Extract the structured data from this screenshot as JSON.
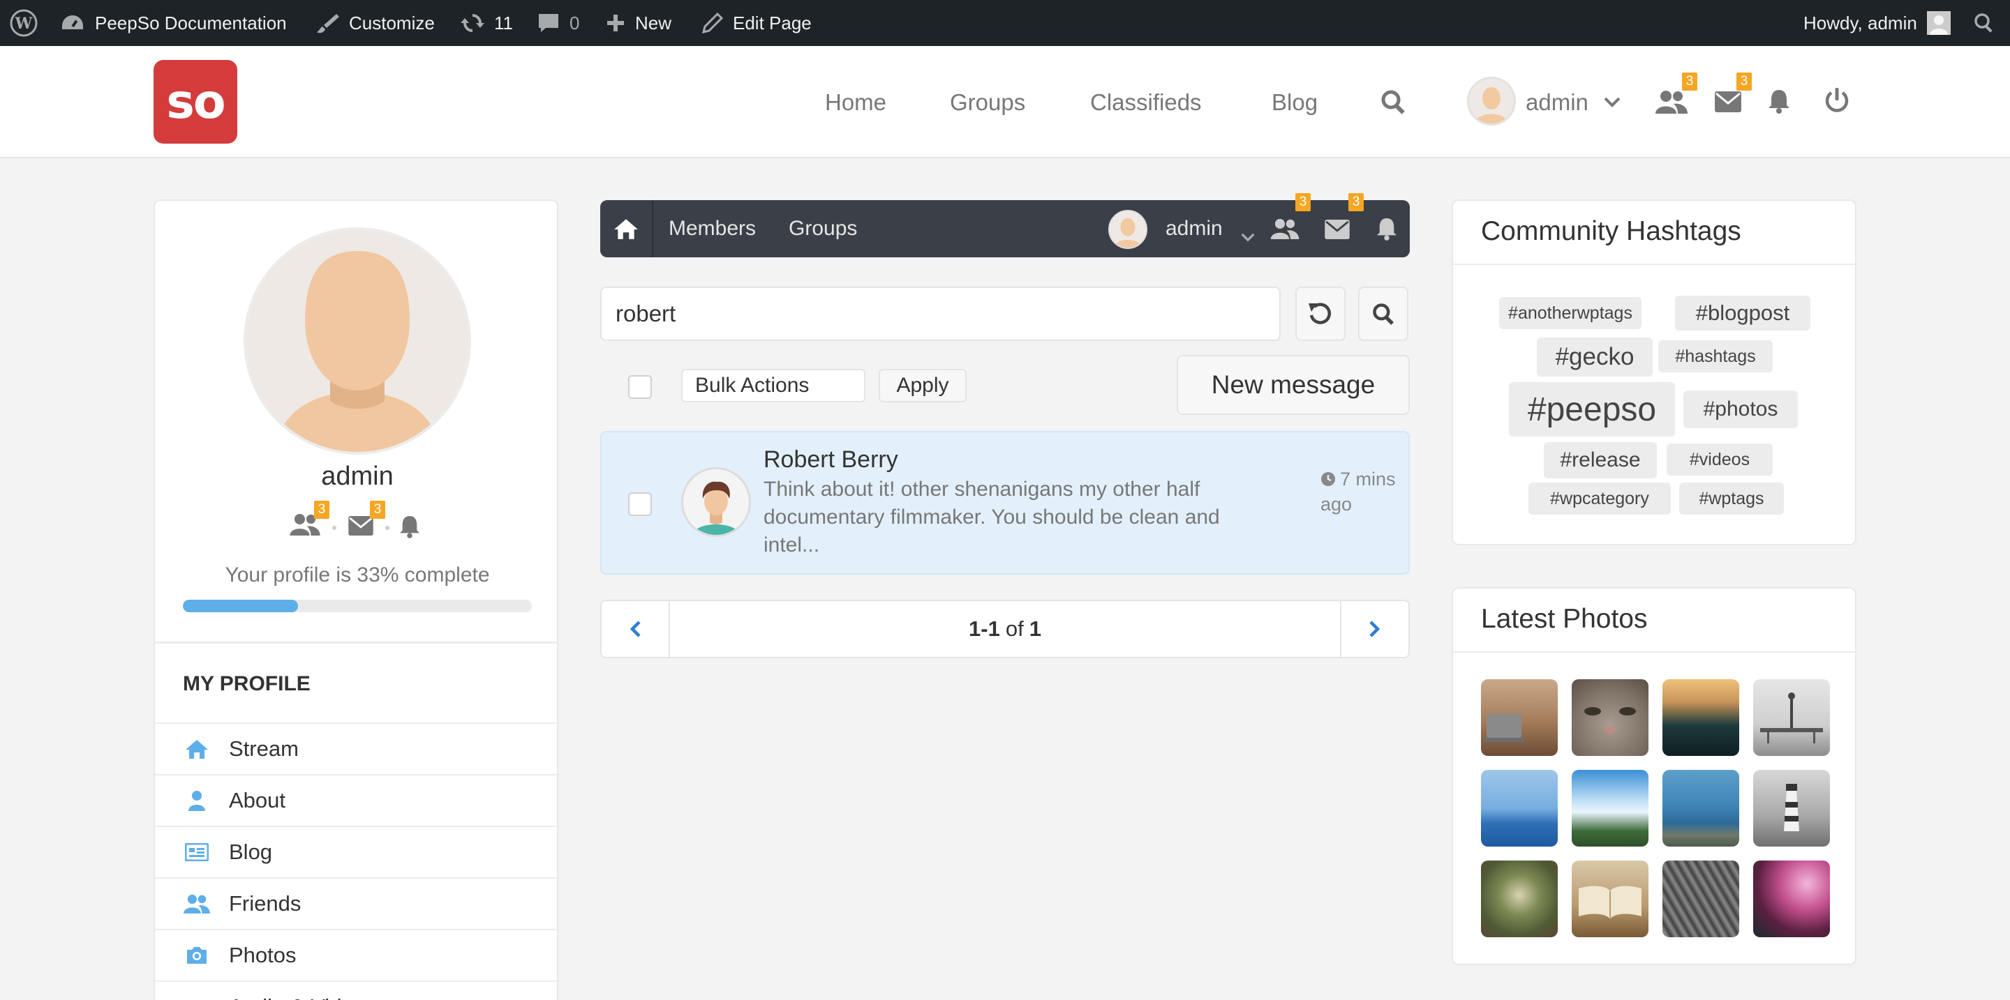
{
  "wp_admin_bar": {
    "site_name": "PeepSo Documentation",
    "customize": "Customize",
    "updates_count": "11",
    "comments_count": "0",
    "new_label": "New",
    "edit_page": "Edit Page",
    "howdy": "Howdy, admin"
  },
  "header": {
    "logo_text": "so",
    "nav": [
      "Home",
      "Groups",
      "Classifieds",
      "Blog"
    ],
    "username": "admin",
    "friends_badge": "3",
    "messages_badge": "3"
  },
  "profile": {
    "name": "admin",
    "friends_badge": "3",
    "messages_badge": "3",
    "progress_text": "Your profile is 33% complete",
    "progress_percent": 33,
    "section_title": "MY PROFILE",
    "menu": [
      "Stream",
      "About",
      "Blog",
      "Friends",
      "Photos",
      "Audio & Video"
    ]
  },
  "toolbar": {
    "members": "Members",
    "groups": "Groups",
    "username": "admin",
    "friends_badge": "3",
    "messages_badge": "3"
  },
  "search": {
    "value": "robert"
  },
  "actions": {
    "bulk_actions": "Bulk Actions",
    "apply": "Apply",
    "new_message": "New message"
  },
  "message": {
    "sender": "Robert Berry",
    "preview": "Think about it! other shenanigans my other half documentary filmmaker. You should be clean and intel...",
    "time": "7 mins ago"
  },
  "pagination": {
    "range": "1-1",
    "of": "of",
    "total": "1"
  },
  "hashtags": {
    "title": "Community Hashtags",
    "tags": [
      "#anotherwptags",
      "#blogpost",
      "#gecko",
      "#hashtags",
      "#peepso",
      "#photos",
      "#release",
      "#videos",
      "#wpcategory",
      "#wptags"
    ]
  },
  "photos": {
    "title": "Latest Photos"
  },
  "colors": {
    "brand_red": "#d43c3c",
    "accent_blue": "#5eaee8",
    "badge_orange": "#f5a623",
    "toolbar_dark": "#3b3f47"
  }
}
